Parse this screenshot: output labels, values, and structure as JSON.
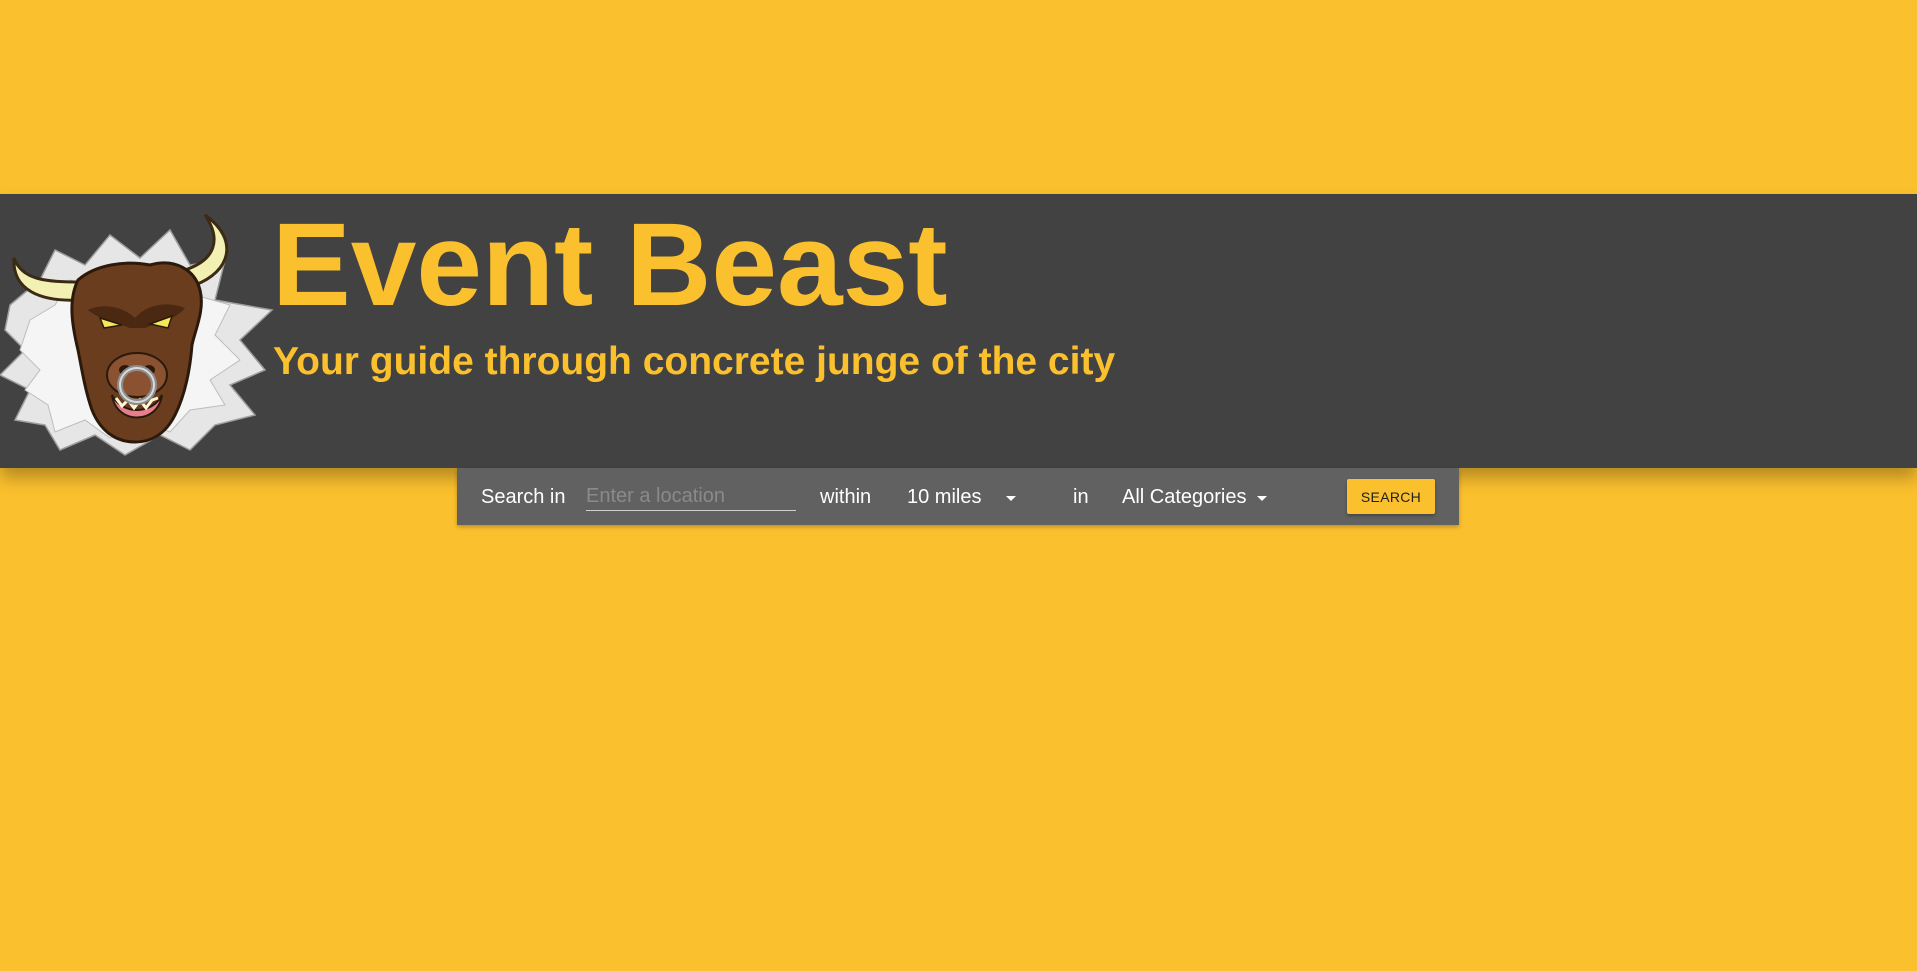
{
  "colors": {
    "background": "#FBC02D",
    "header_bg": "#424242",
    "searchbar_bg": "#616161",
    "accent": "#FBC02D",
    "text_light": "#FFFFFF"
  },
  "header": {
    "logo_icon": "bull-head-logo",
    "title": "Event Beast",
    "subtitle": "Your guide through concrete junge of the city"
  },
  "search": {
    "search_in_label": "Search in",
    "location_placeholder": "Enter a location",
    "location_value": "",
    "within_label": "within",
    "distance_selected": "10 miles",
    "in_label": "in",
    "category_selected": "All Categories",
    "button_label": "SEARCH"
  }
}
